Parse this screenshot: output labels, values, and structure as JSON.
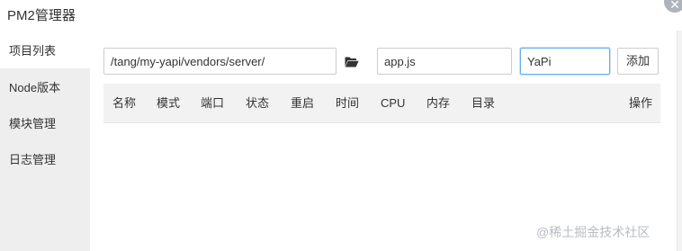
{
  "window": {
    "title": "PM2管理器",
    "close_icon": "close-icon"
  },
  "sidebar": {
    "items": [
      {
        "label": "项目列表",
        "active": true
      },
      {
        "label": "Node版本",
        "active": false
      },
      {
        "label": "模块管理",
        "active": false
      },
      {
        "label": "日志管理",
        "active": false
      }
    ]
  },
  "form": {
    "path_value": "/tang/my-yapi/vendors/server/",
    "folder_icon": "folder-open-icon",
    "startup_file_value": "app.js",
    "project_name_value": "YaPi",
    "add_label": "添加"
  },
  "table": {
    "headers": [
      "名称",
      "模式",
      "端口",
      "状态",
      "重启",
      "时间",
      "CPU",
      "内存",
      "目录",
      "操作"
    ],
    "rows": []
  },
  "watermark": "@稀土掘金技术社区",
  "colors": {
    "sidebar_bg": "#eeeeee",
    "table_header_bg": "#f2f2f2",
    "focus_border": "#66afe9"
  }
}
